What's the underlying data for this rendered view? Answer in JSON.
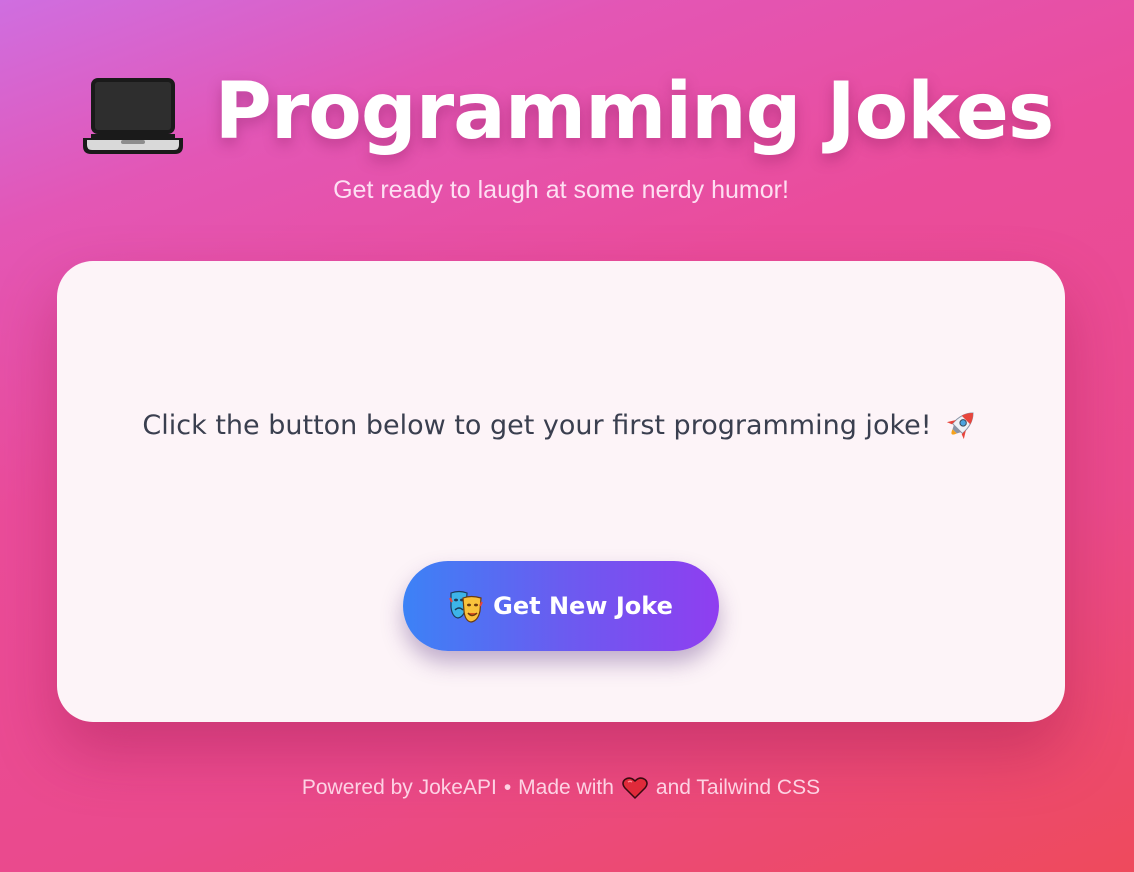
{
  "header": {
    "title": "Programming Jokes",
    "subtitle": "Get ready to laugh at some nerdy humor!",
    "icon": "laptop-icon"
  },
  "card": {
    "prompt": "Click the button below to get your first programming joke!",
    "prompt_icon": "rocket-icon",
    "button_label": "Get New Joke",
    "button_icon": "theater-masks-icon"
  },
  "footer": {
    "powered_by": "Powered by JokeAPI",
    "separator": "•",
    "made_with": "Made with",
    "heart_icon": "heart-icon",
    "and_text": "and Tailwind CSS"
  },
  "colors": {
    "background_start": "#cf6ee0",
    "background_end": "#ee4a5c",
    "card_background": "#fdf4f8",
    "button_gradient_start": "#3c82f6",
    "button_gradient_end": "#8f3ef0",
    "text_dark": "#3a3f4f"
  }
}
